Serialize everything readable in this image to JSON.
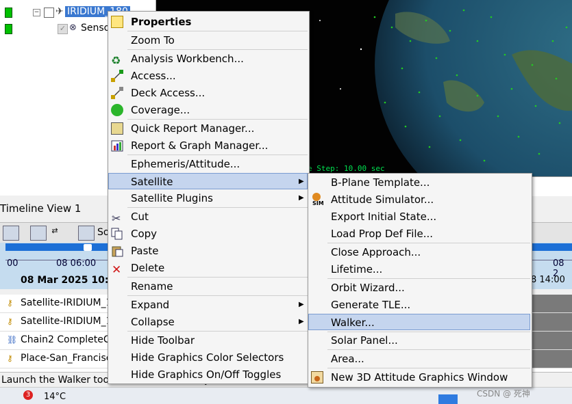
{
  "tree": {
    "items": [
      {
        "label": "IRIDIUM_180",
        "selected": true
      },
      {
        "label": "Senso"
      }
    ]
  },
  "globe": {
    "time_step": "e Step: 10.00 sec"
  },
  "timeline": {
    "title": "Timeline View 1",
    "toolbar_partial_label": "So",
    "ticks": [
      "00",
      "08 06:00",
      "08 2"
    ],
    "date": "08 Mar 2025 10:0",
    "right_date": "8 14:00",
    "rows": [
      {
        "label": "Satellite-IRIDIUM_1"
      },
      {
        "label": "Satellite-IRIDIUM_1"
      },
      {
        "label": "Chain2 CompleteCh"
      },
      {
        "label": "Place-San_Francisco"
      }
    ]
  },
  "status": {
    "text": "Launch the Walker tool for the selected object."
  },
  "taskbar": {
    "weather_badge": "3",
    "temperature": "14°C",
    "watermark": "CSDN @ 死神"
  },
  "context_menu": {
    "items": [
      {
        "label": "Properties",
        "bold": true
      },
      {
        "label": "Zoom To"
      },
      {
        "label": "Analysis Workbench..."
      },
      {
        "label": "Access..."
      },
      {
        "label": "Deck Access..."
      },
      {
        "label": "Coverage..."
      },
      {
        "label": "Quick Report Manager..."
      },
      {
        "label": "Report & Graph Manager..."
      },
      {
        "label": "Ephemeris/Attitude..."
      },
      {
        "label": "Satellite"
      },
      {
        "label": "Satellite Plugins"
      },
      {
        "label": "Cut"
      },
      {
        "label": "Copy"
      },
      {
        "label": "Paste"
      },
      {
        "label": "Delete"
      },
      {
        "label": "Rename"
      },
      {
        "label": "Expand"
      },
      {
        "label": "Collapse"
      },
      {
        "label": "Hide Toolbar"
      },
      {
        "label": "Hide Graphics Color Selectors"
      },
      {
        "label": "Hide Graphics On/Off Toggles"
      }
    ]
  },
  "submenu": {
    "items": [
      {
        "label": "B-Plane Template..."
      },
      {
        "label": "Attitude Simulator..."
      },
      {
        "label": "Export Initial State..."
      },
      {
        "label": "Load Prop Def File..."
      },
      {
        "label": "Close Approach..."
      },
      {
        "label": "Lifetime..."
      },
      {
        "label": "Orbit Wizard..."
      },
      {
        "label": "Generate TLE..."
      },
      {
        "label": "Walker..."
      },
      {
        "label": "Solar Panel..."
      },
      {
        "label": "Area..."
      },
      {
        "label": "New 3D Attitude Graphics Window"
      }
    ],
    "sim_icon_text": "SIM"
  },
  "colors": {
    "highlight": "#c5d5ee",
    "selection": "#3a78d0",
    "timeline_bar": "#1c6fd6",
    "globe_dots": "#22cc22"
  }
}
